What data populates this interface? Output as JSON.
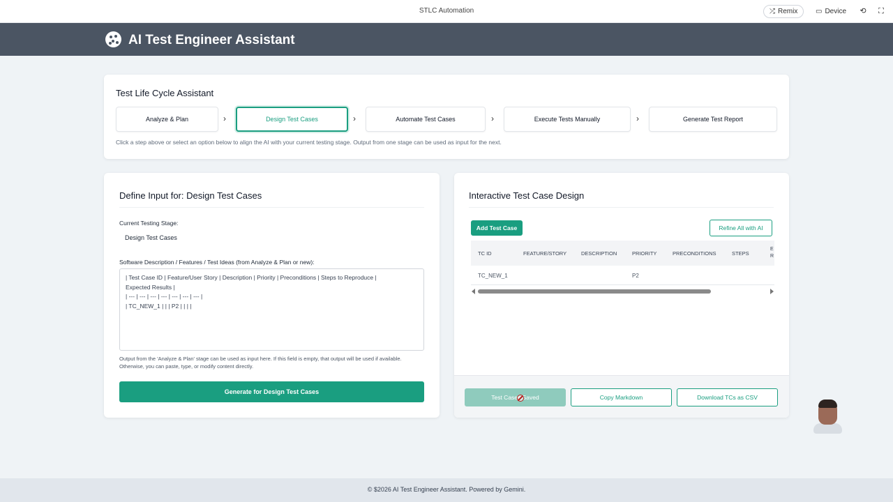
{
  "topbar": {
    "title": "STLC Automation",
    "remix_label": "Remix",
    "device_label": "Device"
  },
  "header": {
    "title": "AI Test Engineer Assistant"
  },
  "lifecycle": {
    "title": "Test Life Cycle Assistant",
    "steps": [
      {
        "label": "Analyze & Plan"
      },
      {
        "label": "Design Test Cases"
      },
      {
        "label": "Automate Test Cases"
      },
      {
        "label": "Execute Tests Manually"
      },
      {
        "label": "Generate Test Report"
      }
    ],
    "active_step": "Design Test Cases",
    "help": "Click a step above or select an option below to align the AI with your current testing stage. Output from one stage can be used as input for the next."
  },
  "input_panel": {
    "title": "Define Input for: Design Test Cases",
    "stage_label": "Current Testing Stage:",
    "stage_value": "Design Test Cases",
    "description_label": "Software Description / Features / Test Ideas (from Analyze & Plan or new):",
    "textarea_value": "| Test Case ID | Feature/User Story | Description | Priority | Preconditions | Steps to Reproduce |\nExpected Results |\n| --- | --- | --- | --- | --- | --- | --- |\n| TC_NEW_1 | | | P2 | | | |",
    "note": "Output from the 'Analyze & Plan' stage can be used as input here. If this field is empty, that output will be used if available. Otherwise, you can paste, type, or modify content directly.",
    "generate_label": "Generate for Design Test Cases"
  },
  "design_panel": {
    "title": "Interactive Test Case Design",
    "add_label": "Add Test Case",
    "refine_label": "Refine All with AI",
    "columns": [
      "TC ID",
      "FEATURE/STORY",
      "DESCRIPTION",
      "PRIORITY",
      "PRECONDITIONS",
      "STEPS"
    ],
    "cut_column": "E\nR",
    "rows": [
      {
        "id": "TC_NEW_1",
        "feature": "",
        "description": "",
        "priority": "P2",
        "preconditions": "",
        "steps": ""
      }
    ],
    "saved_label": "Test Cases Saved",
    "copy_label": "Copy Markdown",
    "download_label": "Download TCs as CSV"
  },
  "footer": {
    "text": "© $2026 AI Test Engineer Assistant. Powered by Gemini."
  },
  "colors": {
    "accent": "#1a9e80",
    "header_bg": "#4b5563",
    "page_bg": "#eff3f6"
  }
}
